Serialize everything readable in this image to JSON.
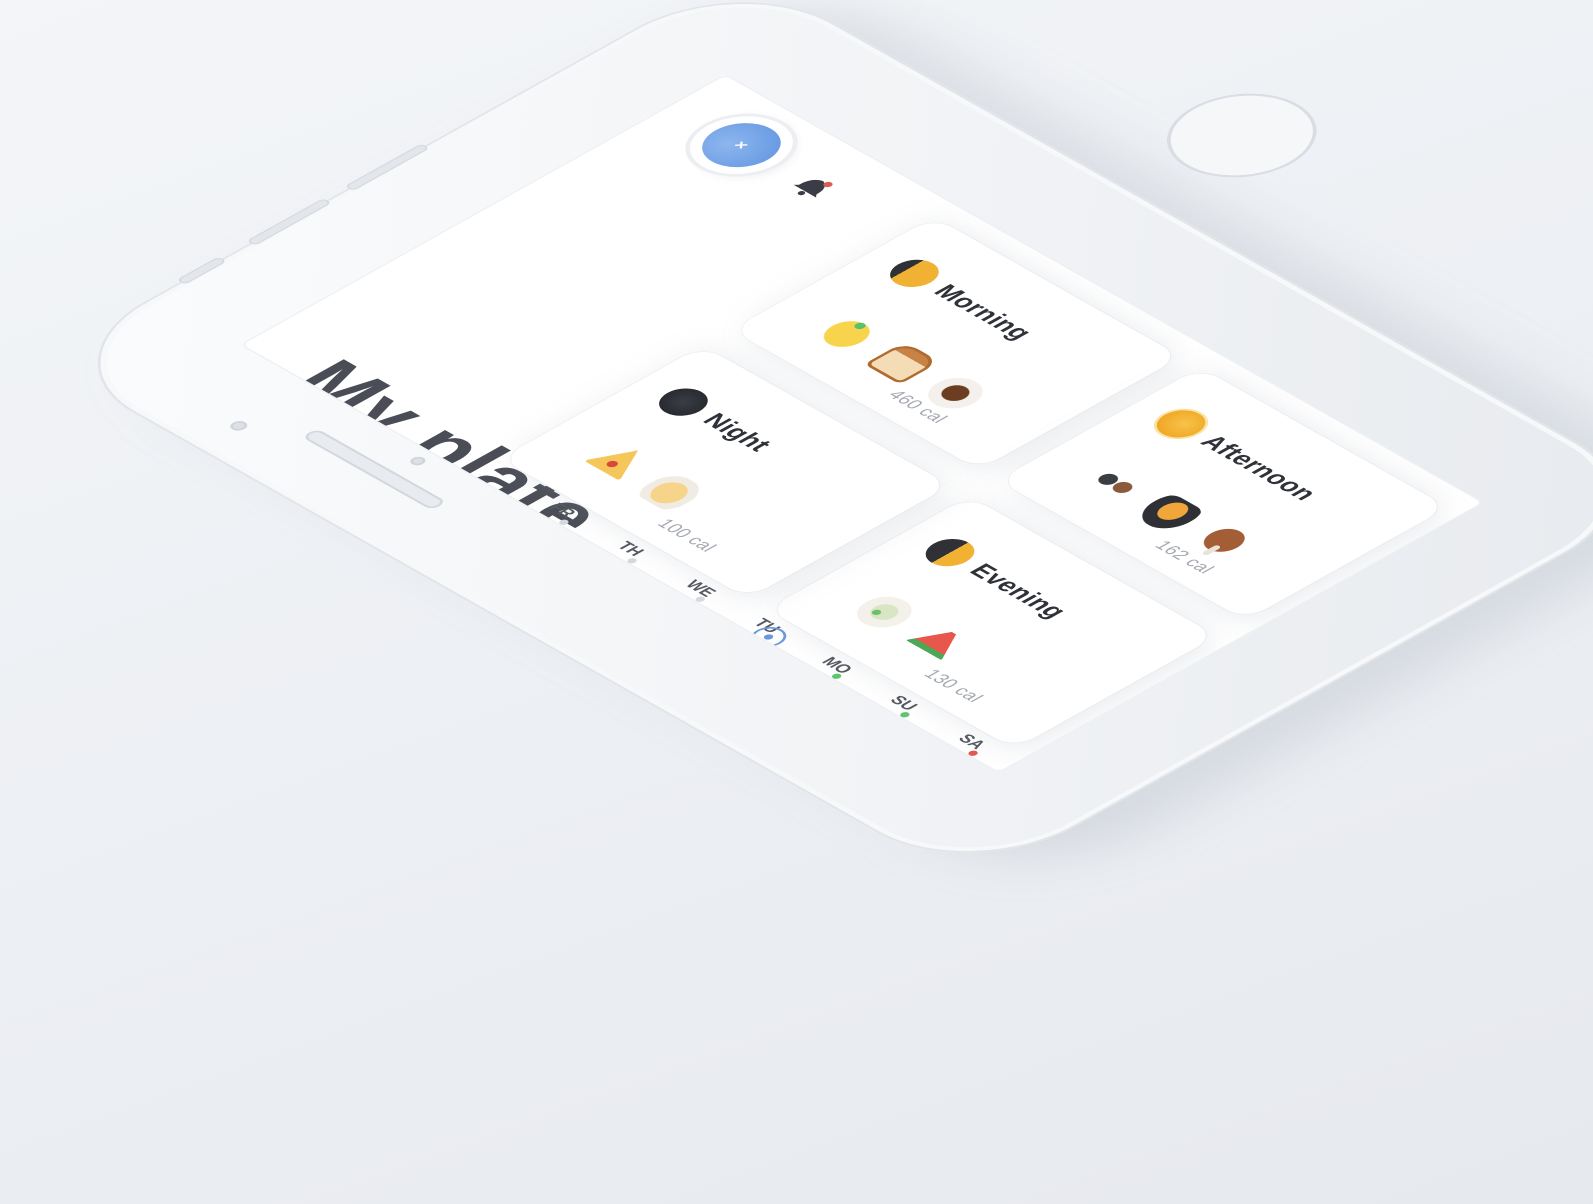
{
  "app": {
    "title": "My plate",
    "avatar_initial": "×",
    "notification_icon": "bell-icon",
    "colors": {
      "accent_blue": "#6a98de",
      "text_dark": "#2f3238",
      "text_muted": "#a4a8b0"
    }
  },
  "meals": [
    {
      "period": "Morning",
      "icon": "sun-icon",
      "foods": [
        "banana-icon",
        "bread-icon",
        "coffee-icon"
      ],
      "calories": "460 cal"
    },
    {
      "period": "Afternoon",
      "icon": "sun-icon",
      "foods": [
        "skewer-icon",
        "pot-icon",
        "drumstick-icon"
      ],
      "calories": "162 cal"
    },
    {
      "period": "Evening",
      "icon": "half-sun-icon",
      "foods": [
        "tea-icon",
        "watermelon-icon"
      ],
      "calories": "130 cal"
    },
    {
      "period": "Night",
      "icon": "moon-icon",
      "foods": [
        "pizza-icon",
        "noodles-icon"
      ],
      "calories": "100 cal"
    }
  ],
  "days": [
    {
      "label": "SA",
      "dot_color": "#e05a4f",
      "active": false
    },
    {
      "label": "SU",
      "dot_color": "#5fc46d",
      "active": false
    },
    {
      "label": "MO",
      "dot_color": "#5fc46d",
      "active": false
    },
    {
      "label": "TU",
      "dot_color": "#6a98de",
      "active": true
    },
    {
      "label": "WE",
      "dot_color": "#d5d8dd",
      "active": false
    },
    {
      "label": "TH",
      "dot_color": "#d5d8dd",
      "active": false
    },
    {
      "label": "FR",
      "dot_color": "#d5d8dd",
      "active": false
    }
  ]
}
